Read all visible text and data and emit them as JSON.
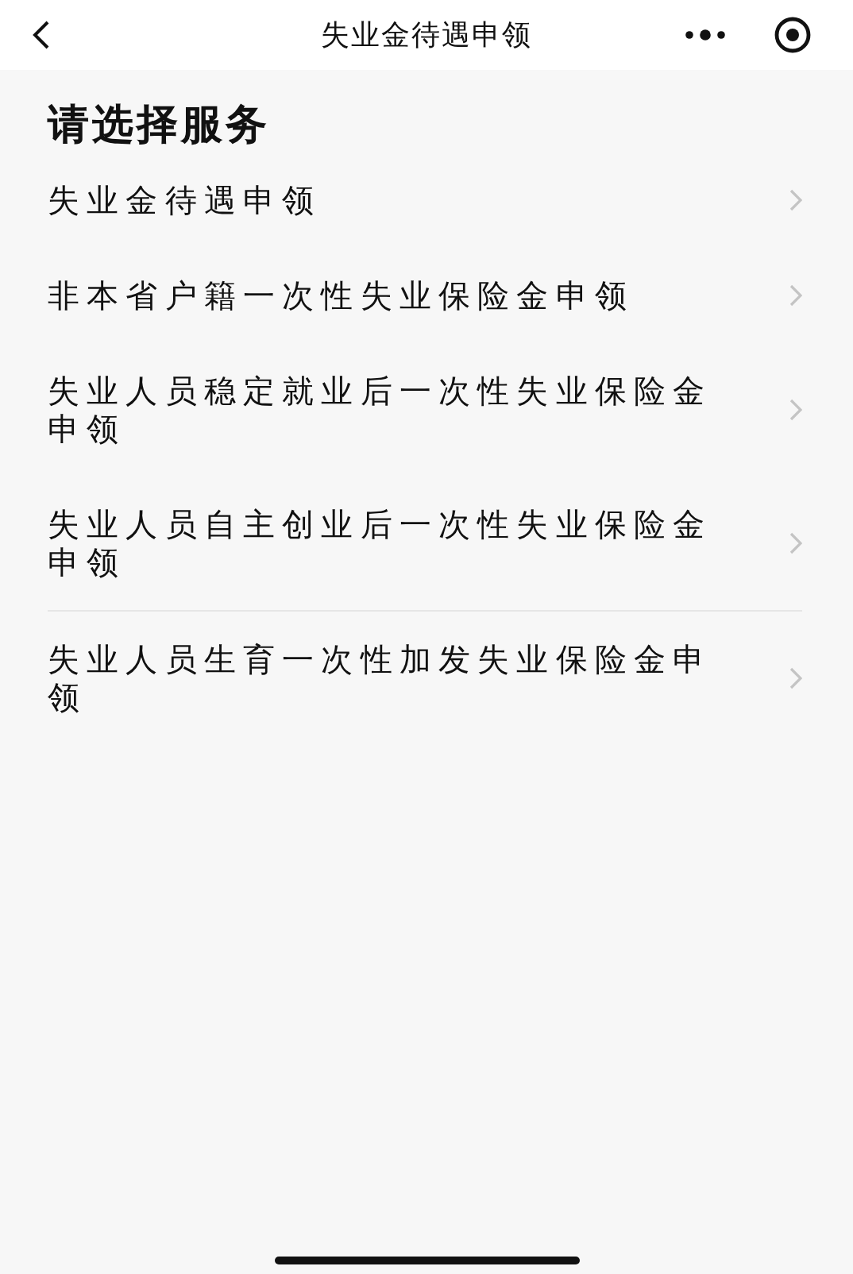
{
  "nav_bar": {
    "title": "失业金待遇申领"
  },
  "heading": "请选择服务",
  "services": [
    {
      "label": "失业金待遇申领"
    },
    {
      "label": "非本省户籍一次性失业保险金申领"
    },
    {
      "label": "失业人员稳定就业后一次性失业保险金申领"
    },
    {
      "label": "失业人员自主创业后一次性失业保险金申领"
    },
    {
      "label": "失业人员生育一次性加发失业保险金申领"
    }
  ]
}
